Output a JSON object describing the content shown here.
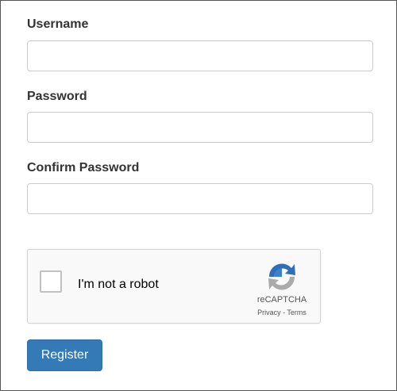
{
  "form": {
    "username_label": "Username",
    "password_label": "Password",
    "confirm_label": "Confirm Password",
    "username_value": "",
    "password_value": "",
    "confirm_value": ""
  },
  "captcha": {
    "checkbox_label": "I'm not a robot",
    "brand": "reCAPTCHA",
    "links": "Privacy - Terms",
    "icon": "recaptcha-logo"
  },
  "register_label": "Register",
  "accent": "#337ab7"
}
